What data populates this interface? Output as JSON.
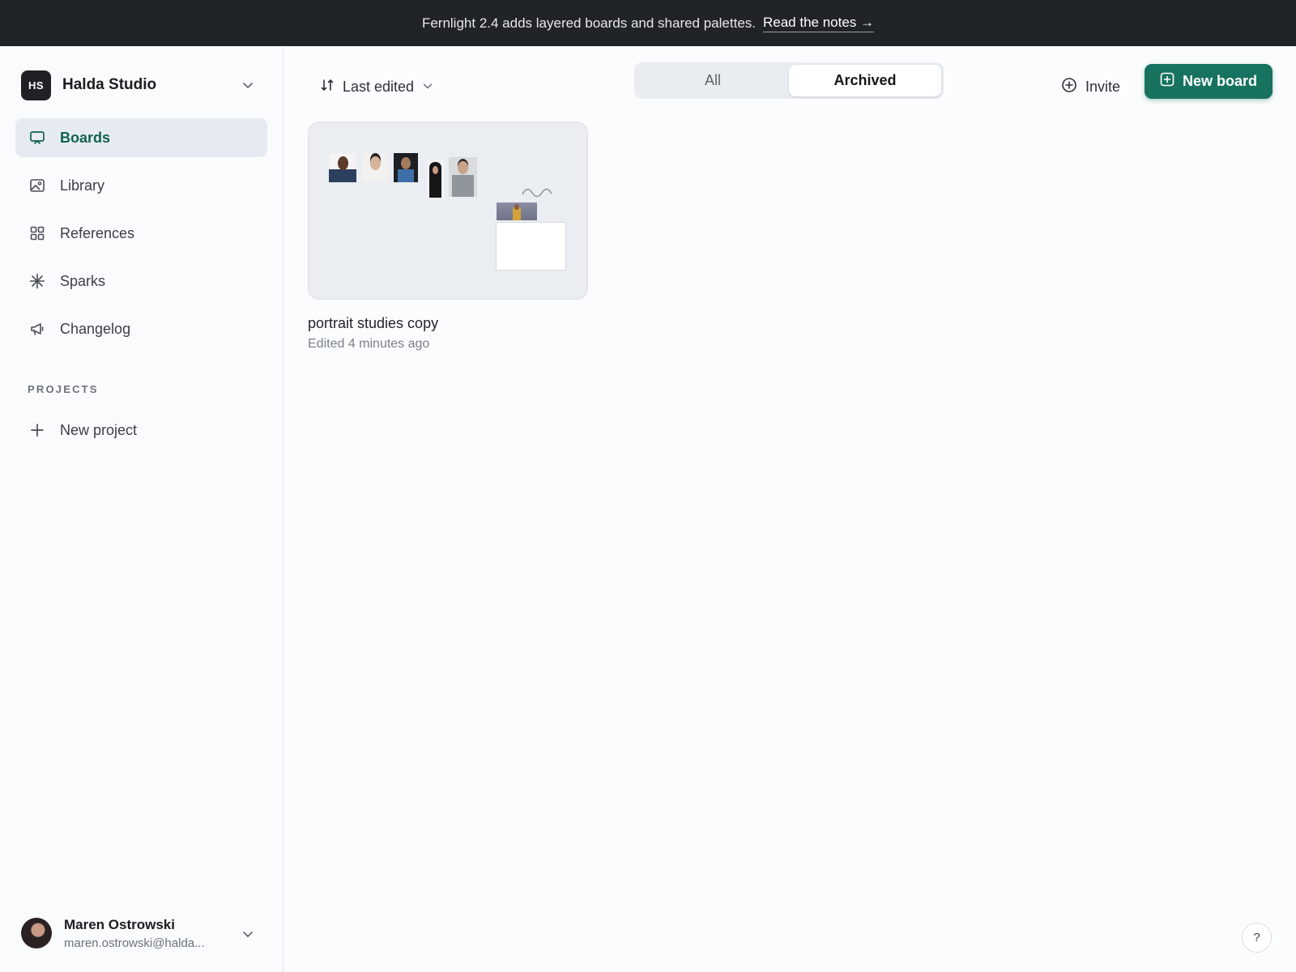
{
  "banner": {
    "message": "Fernlight 2.4 adds layered boards and shared palettes.",
    "link_label": "Read the notes →"
  },
  "workspace": {
    "initials": "HS",
    "name": "Halda Studio"
  },
  "nav": {
    "items": [
      {
        "label": "Boards",
        "icon": "board-icon",
        "active": true
      },
      {
        "label": "Library",
        "icon": "image-icon",
        "active": false
      },
      {
        "label": "References",
        "icon": "grid-icon",
        "active": false
      },
      {
        "label": "Sparks",
        "icon": "sparkle-icon",
        "active": false
      },
      {
        "label": "Changelog",
        "icon": "megaphone-icon",
        "active": false
      }
    ]
  },
  "projects": {
    "heading": "PROJECTS",
    "new_label": "New project"
  },
  "user": {
    "name": "Maren Ostrowski",
    "email": "maren.ostrowski@halda..."
  },
  "toolbar": {
    "sort_label": "Last edited",
    "filter_tabs": [
      {
        "label": "All",
        "active": false
      },
      {
        "label": "Archived",
        "active": true
      }
    ],
    "invite_label": "Invite",
    "new_board_label": "New board"
  },
  "boards": [
    {
      "title": "portrait studies copy",
      "meta": "Edited 4 minutes ago"
    }
  ],
  "help": {
    "label": "?"
  },
  "colors": {
    "accent": "#17735f",
    "active_nav_text": "#126150",
    "banner_bg": "#202327"
  }
}
